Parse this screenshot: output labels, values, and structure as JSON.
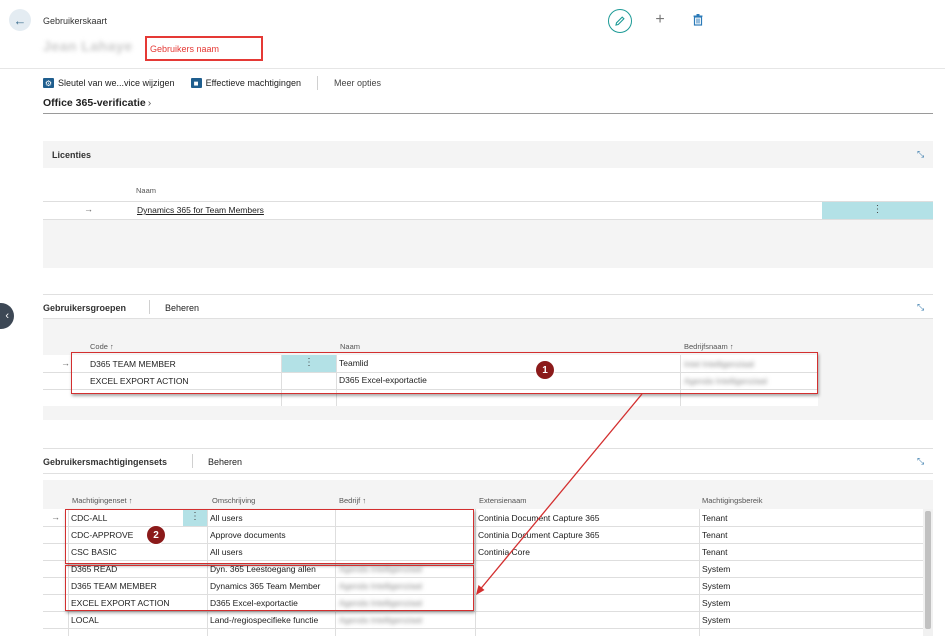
{
  "header": {
    "caption": "Gebruikerskaart",
    "user_name": "Jean Lahaye",
    "name_callout": "Gebruikers naam",
    "back_icon": "arrow-left-icon",
    "edit_icon": "pencil-icon",
    "add_icon": "plus-icon",
    "delete_icon": "trash-icon"
  },
  "actions": {
    "change_key": "Sleutel van we...vice wijzigen",
    "effective_permissions": "Effectieve machtigingen",
    "more_options": "Meer opties"
  },
  "office_section": {
    "title": "Office 365-verificatie",
    "chevron": "›"
  },
  "licenties": {
    "title": "Licenties",
    "col_name": "Naam",
    "row_arrow": "→",
    "rows": [
      {
        "name": "Dynamics 365 for Team Members"
      }
    ],
    "dots": "⋮",
    "expand_icon": "⤡"
  },
  "gebruikersgroepen": {
    "title": "Gebruikersgroepen",
    "manage": "Beheren",
    "col_code": "Code ↑",
    "col_naam": "Naam",
    "col_bedrijf": "Bedrijfsnaam ↑",
    "row_arrow": "→",
    "dots": "⋮",
    "badge": "1",
    "rows": [
      {
        "code": "D365 TEAM MEMBER",
        "naam": "Teamlid",
        "bedrijf": "Intel Intelligenziaal"
      },
      {
        "code": "EXCEL EXPORT ACTION",
        "naam": "D365 Excel-exportactie",
        "bedrijf": "Agenda Intelligenziaal"
      }
    ]
  },
  "machtigingensets": {
    "title": "Gebruikersmachtigingensets",
    "manage": "Beheren",
    "col_set": "Machtigingenset ↑",
    "col_desc": "Omschrijving",
    "col_company": "Bedrijf ↑",
    "col_ext": "Extensienaam",
    "col_scope": "Machtigingsbereik",
    "row_arrow": "→",
    "dots": "⋮",
    "badge": "2",
    "rows": [
      {
        "set": "CDC-ALL",
        "desc": "All users",
        "company": "",
        "ext": "Continia Document Capture 365",
        "scope": "Tenant"
      },
      {
        "set": "CDC-APPROVE",
        "desc": "Approve documents",
        "company": "",
        "ext": "Continia Document Capture 365",
        "scope": "Tenant"
      },
      {
        "set": "CSC BASIC",
        "desc": "All users",
        "company": "",
        "ext": "Continia Core",
        "scope": "Tenant"
      },
      {
        "set": "D365 READ",
        "desc": "Dyn. 365 Leestoegang allen",
        "company": "Agenda Intelligenziaal",
        "ext": "",
        "scope": "System"
      },
      {
        "set": "D365 TEAM MEMBER",
        "desc": "Dynamics 365 Team Member",
        "company": "Agenda Intelligenziaal",
        "ext": "",
        "scope": "System"
      },
      {
        "set": "EXCEL EXPORT ACTION",
        "desc": "D365 Excel-exportactie",
        "company": "Agenda Intelligenziaal",
        "ext": "",
        "scope": "System"
      },
      {
        "set": "LOCAL",
        "desc": "Land-/regiospecifieke functie",
        "company": "Agenda Intelligenziaal",
        "ext": "",
        "scope": "System"
      }
    ]
  },
  "colors": {
    "accent": "#1c9a96",
    "highlight_red": "#d32f2f",
    "badge_red": "#8b1a1a",
    "selection": "#b3e1e6"
  }
}
